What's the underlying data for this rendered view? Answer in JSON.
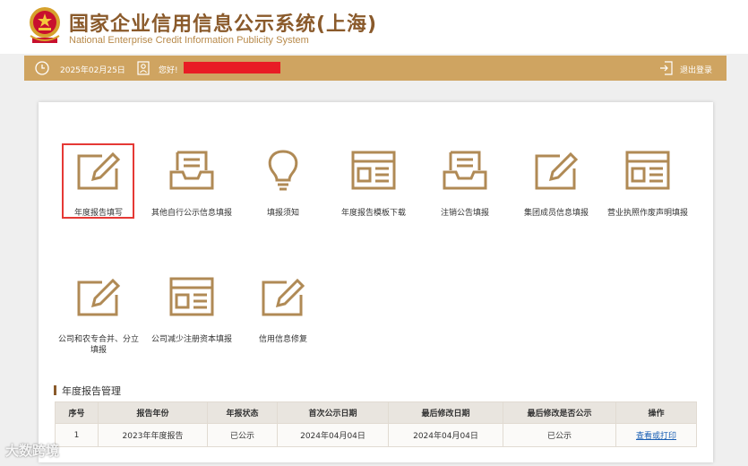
{
  "header": {
    "title": "国家企业信用信息公示系统(上海)",
    "subtitle": "National Enterprise Credit Information Publicity System"
  },
  "infobar": {
    "date": "2025年02月25日",
    "greeting": "您好!",
    "logout": "退出登录"
  },
  "tiles_row1": [
    {
      "label": "年度报告填写",
      "icon": "edit-icon"
    },
    {
      "label": "其他自行公示信息填报",
      "icon": "inbox-icon"
    },
    {
      "label": "填报须知",
      "icon": "lightbulb-icon"
    },
    {
      "label": "年度报告模板下载",
      "icon": "form-icon"
    },
    {
      "label": "注销公告填报",
      "icon": "inbox-icon"
    },
    {
      "label": "集团成员信息填报",
      "icon": "edit-icon"
    },
    {
      "label": "营业执照作废声明填报",
      "icon": "form-icon"
    }
  ],
  "tiles_row2": [
    {
      "label_line1": "公司和农专合并、分立",
      "label_line2": "填报",
      "icon": "edit-icon"
    },
    {
      "label": "公司减少注册资本填报",
      "icon": "form-icon"
    },
    {
      "label": "信用信息修复",
      "icon": "edit-icon"
    }
  ],
  "section": {
    "title": "年度报告管理"
  },
  "table": {
    "headers": [
      "序号",
      "报告年份",
      "年报状态",
      "首次公示日期",
      "最后修改日期",
      "最后修改是否公示",
      "操作"
    ],
    "rows": [
      [
        "1",
        "2023年年度报告",
        "已公示",
        "2024年04月04日",
        "2024年04月04日",
        "已公示",
        "查看或打印"
      ]
    ]
  },
  "watermark": "大数跨境",
  "colors": {
    "brand": "#8a5a2b",
    "gold": "#cfa461",
    "highlight": "#e53935"
  }
}
